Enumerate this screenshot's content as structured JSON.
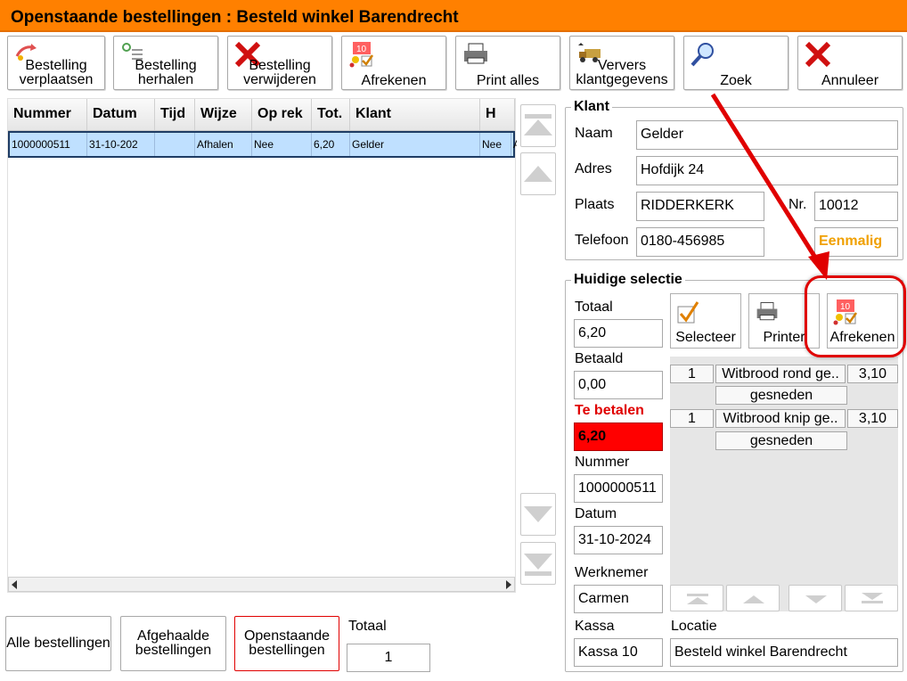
{
  "window": {
    "title": "Openstaande bestellingen : Besteld winkel Barendrecht"
  },
  "toolbar": {
    "move_order": "Bestelling verplaatsen",
    "repeat_order": "Bestelling herhalen",
    "delete_order": "Bestelling verwijderen",
    "checkout": "Afrekenen",
    "print_all": "Print alles",
    "refresh_customer": "Ververs klantgegevens",
    "search": "Zoek",
    "cancel": "Annuleer"
  },
  "orders": {
    "columns": [
      "Nummer",
      "Datum",
      "Tijd",
      "Wijze",
      "Op rek",
      "Tot.",
      "Klant",
      "H"
    ],
    "rows": [
      {
        "nummer": "1000000511",
        "datum": "31-10-202",
        "tijd": "",
        "wijze": "Afhalen",
        "op_rek": "Nee",
        "tot": "6,20",
        "klant": "Gelder",
        "h": "Nee",
        "extra": "A"
      }
    ]
  },
  "customer": {
    "group_title": "Klant",
    "name_label": "Naam",
    "name": "Gelder",
    "address_label": "Adres",
    "address": "Hofdijk 24",
    "city_label": "Plaats",
    "city": "RIDDERKERK",
    "nr_label": "Nr.",
    "nr": "10012",
    "phone_label": "Telefoon",
    "phone": "0180-456985",
    "type": "Eenmalig"
  },
  "selection": {
    "group_title": "Huidige selectie",
    "total_label": "Totaal",
    "total": "6,20",
    "paid_label": "Betaald",
    "paid": "0,00",
    "due_label": "Te betalen",
    "due": "6,20",
    "number_label": "Nummer",
    "number": "1000000511",
    "date_label": "Datum",
    "date": "31-10-2024",
    "employee_label": "Werknemer",
    "employee": "Carmen",
    "register_label": "Kassa",
    "register": "Kassa 10",
    "location_label": "Locatie",
    "location": "Besteld winkel Barendrecht",
    "select_button": "Selecteer",
    "printer_button": "Printer",
    "checkout_button": "Afrekenen",
    "items": [
      {
        "qty": "1",
        "name": "Witbrood rond ge..",
        "price": "3,10",
        "option": "gesneden"
      },
      {
        "qty": "1",
        "name": "Witbrood knip ge..",
        "price": "3,10",
        "option": "gesneden"
      }
    ]
  },
  "bottom": {
    "all_orders": "Alle bestellingen",
    "picked_up": "Afgehaalde bestellingen",
    "open_orders": "Openstaande bestellingen",
    "total_label": "Totaal",
    "total": "1"
  },
  "colors": {
    "accent": "#ff8000",
    "due_bg": "#ff0000",
    "highlight": "#e00000",
    "customer_type": "#f0a000"
  },
  "icons": [
    "move-order-icon",
    "repeat-order-icon",
    "delete-x-icon",
    "checkout-icon",
    "printer-icon",
    "truck-icon",
    "magnifier-icon",
    "cancel-x-icon",
    "checkmark-icon"
  ]
}
